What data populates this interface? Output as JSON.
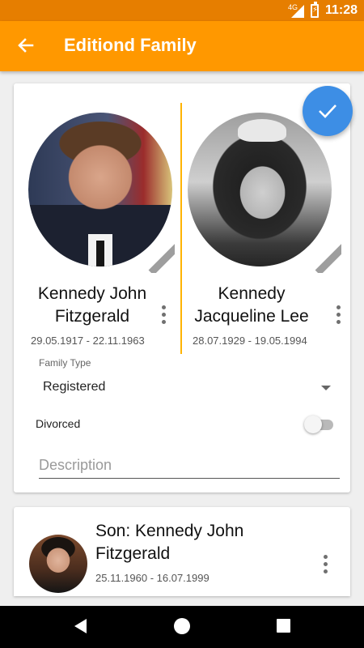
{
  "status_bar": {
    "network": "4G",
    "time": "11:28",
    "battery_icon": "battery-charging-icon"
  },
  "app_bar": {
    "title": "Editiond Family",
    "back_icon": "arrow-back-icon",
    "color": "#ff9800"
  },
  "parents": [
    {
      "name": "Kennedy John Fitzgerald",
      "dates": "29.05.1917 - 22.11.1963"
    },
    {
      "name": "Kennedy Jacqueline Lee",
      "dates": "28.07.1929 - 19.05.1994"
    }
  ],
  "fab": {
    "icon": "check-icon",
    "color": "#3d8ee5"
  },
  "form": {
    "family_type_label": "Family Type",
    "family_type_value": "Registered",
    "divorced_label": "Divorced",
    "divorced": false,
    "description_placeholder": "Description",
    "description_value": ""
  },
  "children": [
    {
      "name": "Son: Kennedy John Fitzgerald",
      "dates": "25.11.1960 - 16.07.1999"
    }
  ],
  "nav_bar": {
    "back_icon": "nav-back-icon",
    "home_icon": "nav-home-icon",
    "recent_icon": "nav-recent-icon"
  }
}
